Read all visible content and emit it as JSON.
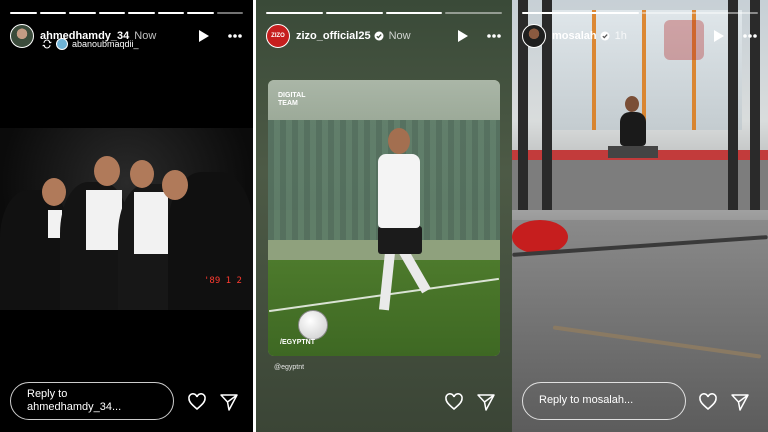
{
  "stories": [
    {
      "username": "ahmedhamdy_34",
      "time": "Now",
      "sub_user": "abanoubmaqdii_",
      "reply_placeholder": "Reply to ahmedhamdy_34...",
      "photo_clock": "'89 1 2",
      "progress_total": 8,
      "progress_done": 8
    },
    {
      "username": "zizo_official25",
      "time": "Now",
      "avatar_text": "ZIZO",
      "card_logo_line1": "DIGITAL",
      "card_logo_line2": "TEAM",
      "card_tag": "/EGYPTNT",
      "mention": "@egyptnt",
      "progress_total": 4,
      "progress_done": 4
    },
    {
      "username": "mosalah",
      "time": "1h",
      "reply_placeholder": "Reply to mosalah...",
      "progress_total": 2,
      "progress_done": 2
    }
  ],
  "colors": {
    "accent_red": "#c61e1e",
    "verified_blue": "#ffffff"
  },
  "icons": [
    "play-icon",
    "more-icon",
    "verified-icon",
    "heart-icon",
    "send-icon",
    "repost-icon"
  ]
}
